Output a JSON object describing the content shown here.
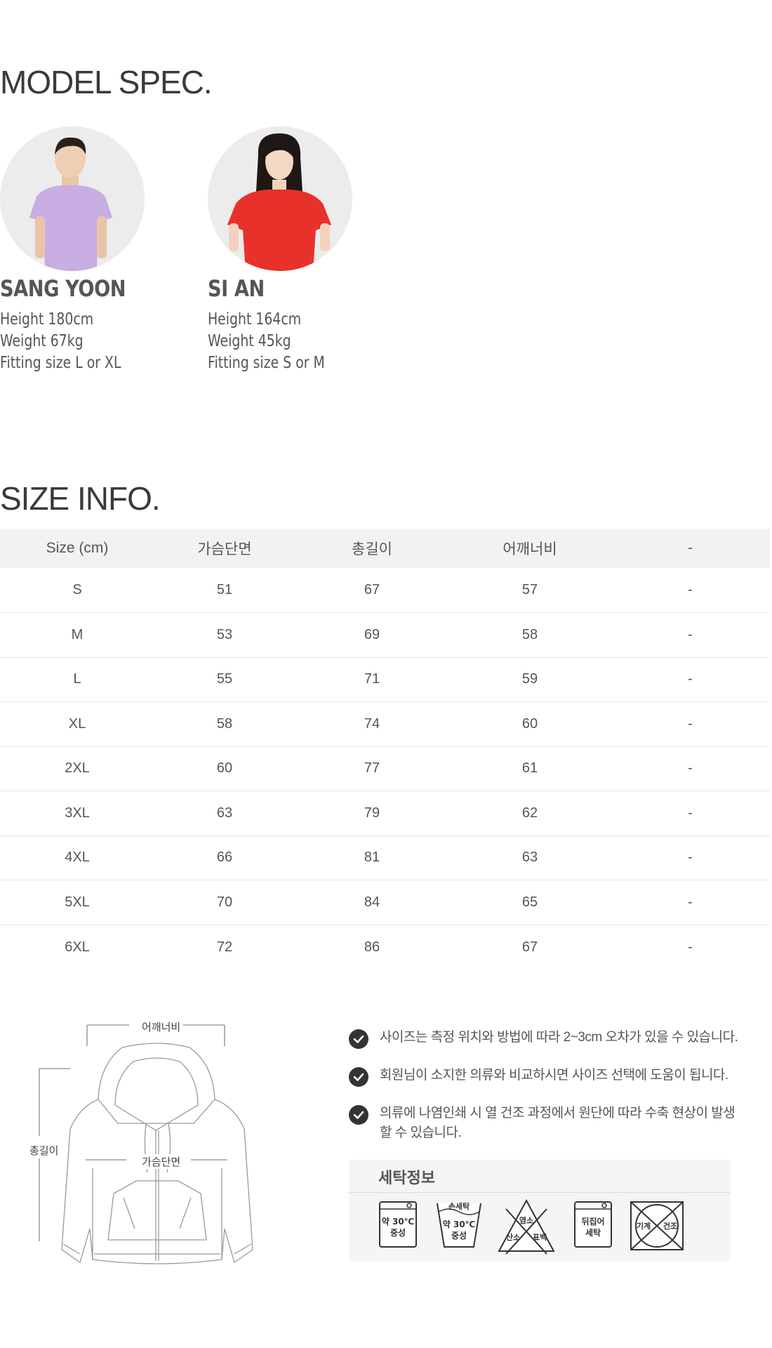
{
  "model_section": {
    "title": "MODEL SPEC.",
    "models": [
      {
        "name": "SANG YOON",
        "height": "Height  180cm",
        "weight": "Weight  67kg",
        "fitting": "Fitting size  L or XL",
        "shirt_color": "#c8aee3"
      },
      {
        "name": "SI AN",
        "height": "Height  164cm",
        "weight": "Weight  45kg",
        "fitting": "Fitting size  S or M",
        "shirt_color": "#e8312b"
      }
    ]
  },
  "size_section": {
    "title": "SIZE INFO.",
    "headers": [
      "Size (cm)",
      "가슴단면",
      "총길이",
      "어깨너비",
      "-"
    ],
    "rows": [
      [
        "S",
        "51",
        "67",
        "57",
        "-"
      ],
      [
        "M",
        "53",
        "69",
        "58",
        "-"
      ],
      [
        "L",
        "55",
        "71",
        "59",
        "-"
      ],
      [
        "XL",
        "58",
        "74",
        "60",
        "-"
      ],
      [
        "2XL",
        "60",
        "77",
        "61",
        "-"
      ],
      [
        "3XL",
        "63",
        "79",
        "62",
        "-"
      ],
      [
        "4XL",
        "66",
        "81",
        "63",
        "-"
      ],
      [
        "5XL",
        "70",
        "84",
        "65",
        "-"
      ],
      [
        "6XL",
        "72",
        "86",
        "67",
        "-"
      ]
    ]
  },
  "diagram": {
    "shoulder_label": "어깨너비",
    "chest_label": "가슴단면",
    "length_label": "총길이"
  },
  "notes": [
    "사이즈는 측정 위치와 방법에 따라 2~3cm 오차가 있을 수 있습니다.",
    "회원님이 소지한 의류와 비교하시면 사이즈 선택에 도움이 됩니다.",
    "의류에 나염인쇄 시 열 건조 과정에서 원단에 따라 수축 현상이 발생할 수 있습니다."
  ],
  "care": {
    "title": "세탁정보",
    "icons": {
      "machine_wash": {
        "line1": "약 30℃",
        "line2": "중성"
      },
      "hand_wash": {
        "top": "손세탁",
        "line1": "약 30℃",
        "line2": "중성"
      },
      "no_bleach": {
        "top": "염소",
        "left": "산소",
        "right": "표백"
      },
      "inside_out": {
        "line1": "뒤집어",
        "line2": "세탁"
      },
      "no_machine_dry": {
        "left": "기계",
        "right": "건조"
      }
    }
  }
}
